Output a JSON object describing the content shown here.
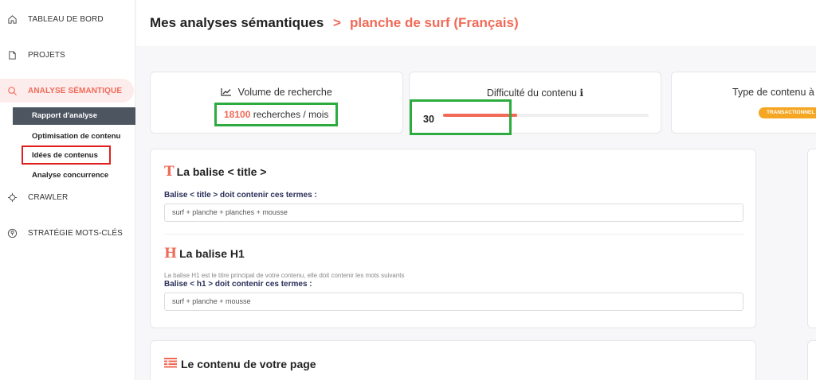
{
  "sidebar": {
    "items": [
      {
        "label": "TABLEAU DE BORD",
        "icon": "home-icon"
      },
      {
        "label": "PROJETS",
        "icon": "document-icon"
      },
      {
        "label": "ANALYSE SÉMANTIQUE",
        "icon": "search-icon"
      },
      {
        "label": "CRAWLER",
        "icon": "crosshair-icon"
      },
      {
        "label": "STRATÉGIE MOTS-CLÉS",
        "icon": "key-icon"
      }
    ],
    "sub_items": [
      {
        "label": "Rapport d'analyse"
      },
      {
        "label": "Optimisation de contenu"
      },
      {
        "label": "Idées de contenus"
      },
      {
        "label": "Analyse concurrence"
      }
    ]
  },
  "header": {
    "title": "Mes analyses sémantiques",
    "separator": ">",
    "subtitle": "planche de surf (Français)"
  },
  "stats": {
    "volume": {
      "title": "Volume de recherche",
      "value": "18100",
      "unit": "recherches / mois"
    },
    "difficulty": {
      "title": "Difficulté du contenu",
      "info": "ℹ",
      "value": "30",
      "level": 0.36
    },
    "type": {
      "title": "Type de contenu à",
      "badge": "TRANSACTIONNEL"
    }
  },
  "title_section": {
    "icon": "T",
    "title": "La balise < title >",
    "label": "Balise < title > doit contenir ces termes :",
    "value": "surf + planche + planches + mousse"
  },
  "h1_section": {
    "icon": "H",
    "title": "La balise H1",
    "help": "La balise H1 est le titre principal de votre contenu, elle doit contenir les mots suivants",
    "label": "Balise < h1 > doit contenir ces termes :",
    "value": "surf + planche + mousse"
  },
  "content_section": {
    "title": "Le contenu de votre page"
  },
  "colors": {
    "accent": "#f06a57",
    "badge": "#f5a623",
    "highlight_green": "#2dab3f",
    "highlight_red": "#e0201e",
    "selected_bg": "#4d5560"
  }
}
